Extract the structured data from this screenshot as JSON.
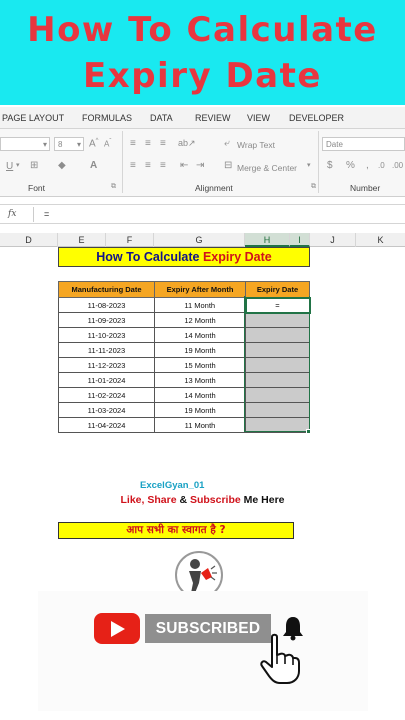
{
  "banner": {
    "line1": "How To Calculate",
    "line2": "Expiry Date"
  },
  "ribbon_tabs": [
    "PAGE LAYOUT",
    "FORMULAS",
    "DATA",
    "REVIEW",
    "VIEW",
    "DEVELOPER"
  ],
  "ribbon": {
    "font_size": "8",
    "wrap_text": "Wrap Text",
    "merge_center": "Merge & Center",
    "number_format": "Date",
    "group_font": "Font",
    "group_alignment": "Alignment",
    "group_number": "Number"
  },
  "formula_bar": {
    "fx": "fx",
    "value": "="
  },
  "columns": [
    "D",
    "E",
    "F",
    "G",
    "H",
    "I",
    "J",
    "K"
  ],
  "sheet_title": {
    "part1": "How To Calculate ",
    "part2": "Expiry Date"
  },
  "table": {
    "headers": [
      "Manufacturing Date",
      "Expiry After Month",
      "Expiry Date"
    ],
    "rows": [
      {
        "mfg": "11-08-2023",
        "months": "11 Month",
        "expiry": "="
      },
      {
        "mfg": "11-09-2023",
        "months": "12 Month",
        "expiry": ""
      },
      {
        "mfg": "11-10-2023",
        "months": "14 Month",
        "expiry": ""
      },
      {
        "mfg": "11-11-2023",
        "months": "19 Month",
        "expiry": ""
      },
      {
        "mfg": "11-12-2023",
        "months": "15 Month",
        "expiry": ""
      },
      {
        "mfg": "11-01-2024",
        "months": "13 Month",
        "expiry": ""
      },
      {
        "mfg": "11-02-2024",
        "months": "14 Month",
        "expiry": ""
      },
      {
        "mfg": "11-03-2024",
        "months": "19 Month",
        "expiry": ""
      },
      {
        "mfg": "11-04-2024",
        "months": "11 Month",
        "expiry": ""
      }
    ]
  },
  "credit": "ExcelGyan_01",
  "cta": {
    "like_share": "Like, Share ",
    "amp": "& ",
    "subscribe": "Subscribe ",
    "me_here": "Me Here"
  },
  "hindi_banner": "आप सभी का स्वागत है ?",
  "subscribe_button": "SUBSCRIBED",
  "colors": {
    "banner_bg": "#19e9f0",
    "banner_text": "#e8363f",
    "header_orange": "#f5a623",
    "yellow": "#ffff00",
    "excel_green": "#217346",
    "youtube_red": "#e62117"
  },
  "icons": [
    "youtube-play-icon",
    "bell-icon",
    "pointing-hand-icon",
    "avatar-icon"
  ]
}
